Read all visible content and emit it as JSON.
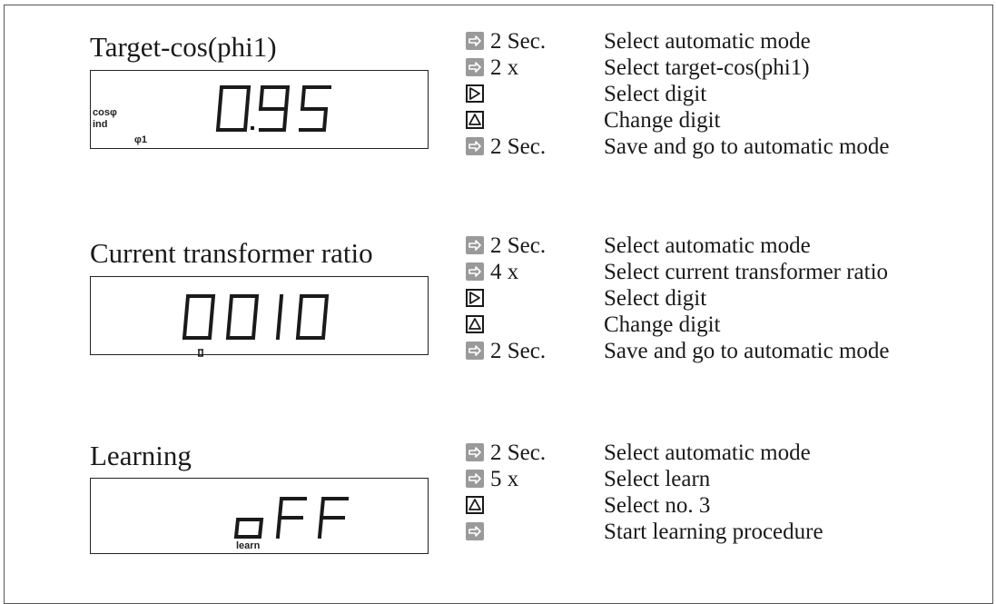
{
  "sections": [
    {
      "title": "Target-cos(phi1)",
      "display": {
        "value": "0.95",
        "tags": [
          "cosφ",
          "ind",
          "φ1"
        ]
      },
      "steps": [
        {
          "key": "arrow-key-icon",
          "qty": "2 Sec.",
          "desc": "Select automatic mode"
        },
        {
          "key": "arrow-key-icon",
          "qty": "2 x",
          "desc": "Select target-cos(phi1)"
        },
        {
          "key": "right-triangle-key-icon",
          "qty": "",
          "desc": "Select digit"
        },
        {
          "key": "up-triangle-key-icon",
          "qty": "",
          "desc": "Change digit"
        },
        {
          "key": "arrow-key-icon",
          "qty": "2 Sec.",
          "desc": "Save and go to automatic mode"
        }
      ]
    },
    {
      "title": "Current transformer ratio",
      "display": {
        "value": "0010",
        "tags": []
      },
      "steps": [
        {
          "key": "arrow-key-icon",
          "qty": "2 Sec.",
          "desc": "Select automatic mode"
        },
        {
          "key": "arrow-key-icon",
          "qty": "4 x",
          "desc": "Select current transformer ratio"
        },
        {
          "key": "right-triangle-key-icon",
          "qty": "",
          "desc": "Select digit"
        },
        {
          "key": "up-triangle-key-icon",
          "qty": "",
          "desc": "Change digit"
        },
        {
          "key": "arrow-key-icon",
          "qty": "2 Sec.",
          "desc": "Save and go to automatic mode"
        }
      ]
    },
    {
      "title": "Learning",
      "display": {
        "value": "oFF",
        "tags": [
          "learn"
        ]
      },
      "steps": [
        {
          "key": "arrow-key-icon",
          "qty": "2 Sec.",
          "desc": "Select automatic mode"
        },
        {
          "key": "arrow-key-icon",
          "qty": "5 x",
          "desc": "Select learn"
        },
        {
          "key": "up-triangle-key-icon",
          "qty": "",
          "desc": "Select no. 3"
        },
        {
          "key": "arrow-key-icon",
          "qty": "",
          "desc": "Start learning procedure"
        }
      ]
    }
  ]
}
